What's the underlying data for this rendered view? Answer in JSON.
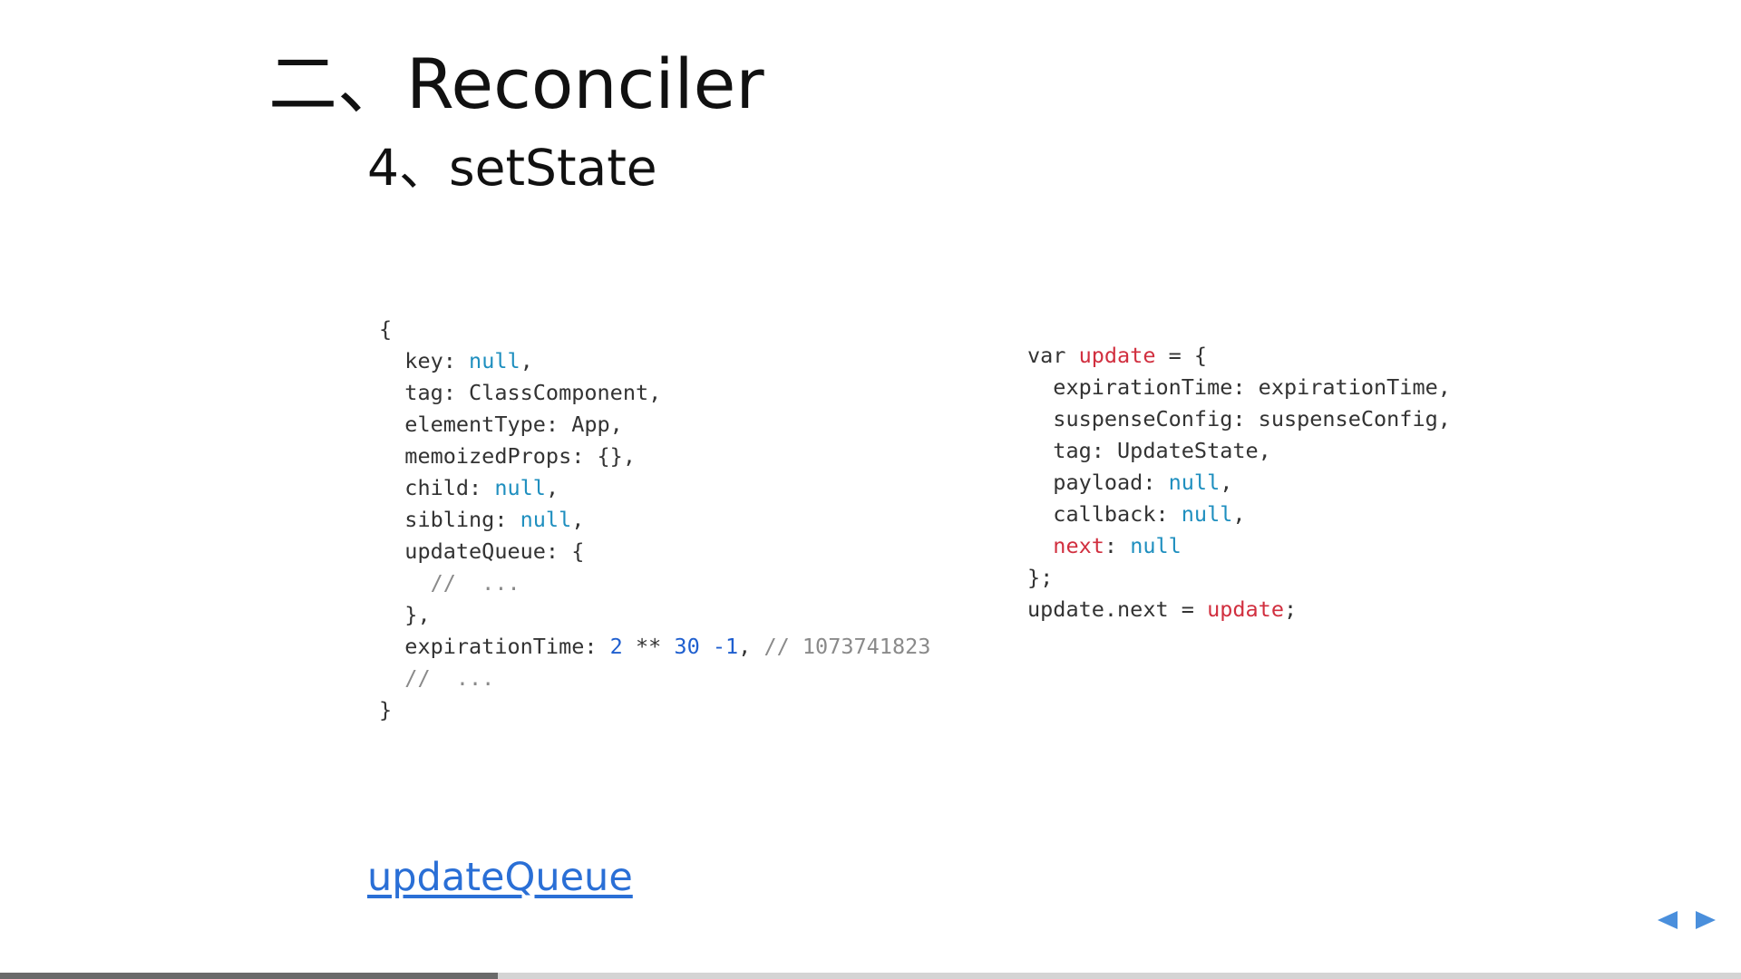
{
  "slide": {
    "title": "二、Reconciler",
    "subtitle": "4、setState",
    "link_text": "updateQueue"
  },
  "code_left": {
    "lines": [
      [
        {
          "t": "{",
          "k": "plain"
        }
      ],
      [
        {
          "t": "  key: ",
          "k": "plain"
        },
        {
          "t": "null",
          "k": "null"
        },
        {
          "t": ",",
          "k": "plain"
        }
      ],
      [
        {
          "t": "  tag: ClassComponent,",
          "k": "plain"
        }
      ],
      [
        {
          "t": "  elementType: App,",
          "k": "plain"
        }
      ],
      [
        {
          "t": "  memoizedProps: {},",
          "k": "plain"
        }
      ],
      [
        {
          "t": "  child: ",
          "k": "plain"
        },
        {
          "t": "null",
          "k": "null"
        },
        {
          "t": ",",
          "k": "plain"
        }
      ],
      [
        {
          "t": "  sibling: ",
          "k": "plain"
        },
        {
          "t": "null",
          "k": "null"
        },
        {
          "t": ",",
          "k": "plain"
        }
      ],
      [
        {
          "t": "  updateQueue: {",
          "k": "plain"
        }
      ],
      [
        {
          "t": "    //  ...",
          "k": "comment"
        }
      ],
      [
        {
          "t": "  },",
          "k": "plain"
        }
      ],
      [
        {
          "t": "  expirationTime: ",
          "k": "plain"
        },
        {
          "t": "2",
          "k": "number"
        },
        {
          "t": " ** ",
          "k": "plain"
        },
        {
          "t": "30",
          "k": "number"
        },
        {
          "t": " ",
          "k": "plain"
        },
        {
          "t": "-1",
          "k": "number"
        },
        {
          "t": ", ",
          "k": "plain"
        },
        {
          "t": "// 1073741823",
          "k": "comment"
        }
      ],
      [
        {
          "t": "  //  ...",
          "k": "comment"
        }
      ],
      [
        {
          "t": "}",
          "k": "plain"
        }
      ]
    ]
  },
  "code_right": {
    "lines": [
      [
        {
          "t": "var ",
          "k": "plain"
        },
        {
          "t": "update",
          "k": "red"
        },
        {
          "t": " = {",
          "k": "plain"
        }
      ],
      [
        {
          "t": "  expirationTime: expirationTime,",
          "k": "plain"
        }
      ],
      [
        {
          "t": "  suspenseConfig: suspenseConfig,",
          "k": "plain"
        }
      ],
      [
        {
          "t": "  tag: UpdateState,",
          "k": "plain"
        }
      ],
      [
        {
          "t": "  payload: ",
          "k": "plain"
        },
        {
          "t": "null",
          "k": "null"
        },
        {
          "t": ",",
          "k": "plain"
        }
      ],
      [
        {
          "t": "  callback: ",
          "k": "plain"
        },
        {
          "t": "null",
          "k": "null"
        },
        {
          "t": ",",
          "k": "plain"
        }
      ],
      [
        {
          "t": "  ",
          "k": "plain"
        },
        {
          "t": "next",
          "k": "red"
        },
        {
          "t": ": ",
          "k": "plain"
        },
        {
          "t": "null",
          "k": "null"
        }
      ],
      [
        {
          "t": "};",
          "k": "plain"
        }
      ],
      [
        {
          "t": "update.next = ",
          "k": "plain"
        },
        {
          "t": "update",
          "k": "red"
        },
        {
          "t": ";",
          "k": "plain"
        }
      ]
    ]
  },
  "navigation": {
    "prev_icon": "triangle-left-icon",
    "next_icon": "triangle-right-icon",
    "arrow_color": "#4a8fdc",
    "progress_fraction": 0.286
  },
  "colors": {
    "null_keyword": "#1f8fbf",
    "number": "#1f5fcf",
    "comment": "#8a8a8a",
    "highlight_red": "#d12f3f",
    "link": "#2a6fd6"
  }
}
